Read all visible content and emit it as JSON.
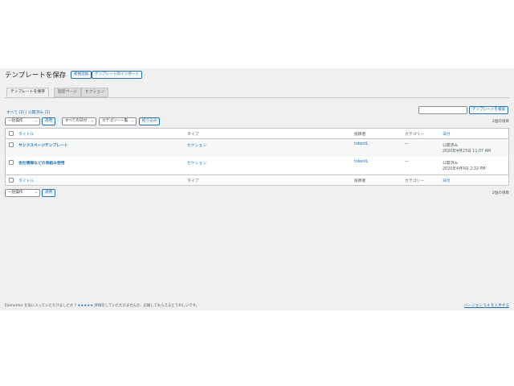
{
  "page": {
    "title": "テンプレートを保存",
    "add_new": "新規追加",
    "import": "テンプレートのインポート"
  },
  "tabs": [
    {
      "label": "テンプレートを保存"
    },
    {
      "label": "固定ページ"
    },
    {
      "label": "セクション"
    }
  ],
  "filters": {
    "all": "すべて (2)",
    "separator": " | ",
    "published": "公開済み (2)"
  },
  "search": {
    "button": "テンプレートを検索"
  },
  "toolbar": {
    "bulk_action": "一括操作",
    "apply": "適用",
    "dates": "すべての日付",
    "category": "カテゴリー一覧",
    "filter": "絞り込み",
    "count": "2個の項目"
  },
  "table": {
    "columns": {
      "title": "タイトル",
      "type": "タイプ",
      "author": "投稿者",
      "category": "カテゴリー",
      "date": "日付"
    },
    "rows": [
      {
        "title": "サンクスページテンプレート",
        "type": "セクション",
        "author": "tokenIL",
        "category": "—",
        "status": "公開済み",
        "date": "2020年4月23日 11:07 AM"
      },
      {
        "title": "会社情報などの表組み使用",
        "type": "セクション",
        "author": "tokenIL",
        "category": "—",
        "status": "公開済み",
        "date": "2020年4月9日 2:32 PM"
      }
    ]
  },
  "bottom_toolbar": {
    "bulk_action": "一括操作",
    "apply": "適用",
    "count": "2個の項目"
  },
  "footer": {
    "left_prefix": "Elementor を気に入っていただけましたか ?",
    "stars": "★★★★★",
    "left_suffix": "評価をしていただけませんか。応援してもらえるとうれしいです。",
    "version": "バージョン 5.4 を入手する"
  }
}
